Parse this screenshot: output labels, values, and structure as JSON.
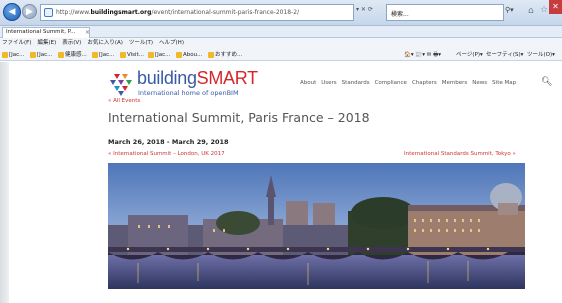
{
  "browser": {
    "url_prefix": "http://www.",
    "url_host": "buildingsmart.org",
    "url_path": "/event/international-summit-paris-france-2018-2/",
    "address_controls": "▾ ✕ ⟳",
    "search_text": "検索...",
    "tab_title": "International Summit, P...",
    "menu": [
      "ファイル(F)",
      "編集(E)",
      "表示(V)",
      "お気に入り(A)",
      "ツール(T)",
      "ヘルプ(H)"
    ],
    "favorites": [
      "[Jac...",
      "[Jac...",
      "健康感...",
      "[Jac...",
      "Visit...",
      "[Jac...",
      "Abou...",
      "おすすめ..."
    ],
    "commands": [
      "ページ(P)▾",
      "セーフティ(S)▾",
      "ツール(O)▾"
    ]
  },
  "site": {
    "logo_word_1": "building",
    "logo_word_2": "SMART",
    "logo_tagline": "International home of openBIM",
    "nav": [
      "About",
      "Users",
      "Standards",
      "Compliance",
      "Chapters",
      "Members",
      "News",
      "Site Map"
    ]
  },
  "event": {
    "back_link": "« All Events",
    "title": "International Summit, Paris France – 2018",
    "dates": "March 26, 2018 - March 29, 2018",
    "prev_link": "« International Summit – London, UK 2017",
    "next_link": "International Standards Summit, Tokyo »"
  },
  "colors": {
    "brand_blue": "#3a5aa6",
    "brand_red": "#d5262b",
    "link_red": "#cc3333"
  }
}
